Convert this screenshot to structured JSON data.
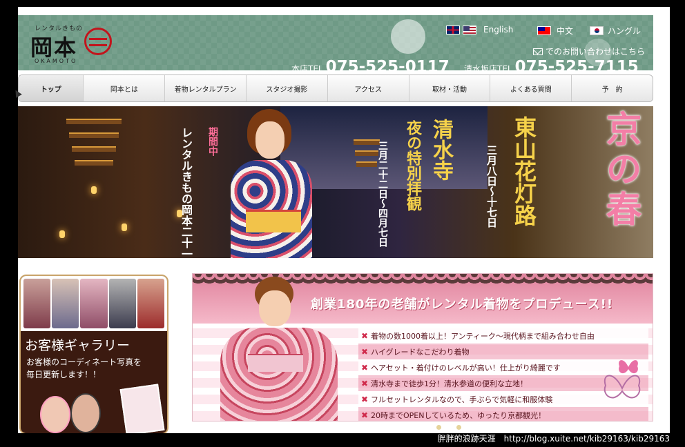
{
  "logo": {
    "kana": "レンタルきもの",
    "name": "岡本",
    "roman": "OKAMOTO"
  },
  "languages": [
    {
      "label": "English",
      "flags": [
        "uk-flag-icon",
        "us-flag-icon"
      ]
    },
    {
      "label": "中文",
      "flags": [
        "tw-flag-icon"
      ]
    },
    {
      "label": "ハングル",
      "flags": [
        "kr-flag-icon"
      ]
    }
  ],
  "contact": {
    "label": "でのお問い合わせはこちら",
    "icon": "mail-icon"
  },
  "phones": [
    {
      "label": "本店TEL",
      "number": "075-525-0117"
    },
    {
      "label": "清水坂店TEL",
      "number": "075-525-7115"
    }
  ],
  "nav": [
    {
      "label": "トップ",
      "active": true
    },
    {
      "label": "岡本とは"
    },
    {
      "label": "着物レンタルプラン"
    },
    {
      "label": "スタジオ撮影"
    },
    {
      "label": "アクセス"
    },
    {
      "label": "取材・活動"
    },
    {
      "label": "よくある質問"
    },
    {
      "label": "予　約"
    }
  ],
  "banner": {
    "period_label": "期間中",
    "hours": "レンタルきもの岡本二十一時まで営業",
    "kiyomizu_title": "清水寺",
    "kiyomizu_sub": "夜の特別拝観",
    "kiyomizu_dates": "三月二十二日〜四月七日",
    "hanatoro_title": "東山花灯路",
    "hanatoro_dates": "三月八日〜十七日",
    "spring": "京の春",
    "colors": {
      "spring": "#f37ea6",
      "gold": "#f6d24a"
    }
  },
  "gallery": {
    "title": "お客様ギャラリー",
    "desc_line1": "お客様のコーディネート写真を",
    "desc_line2": "毎日更新します！！"
  },
  "promo": {
    "title": "創業180年の老舗がレンタル着物をプロデュース!!",
    "items": [
      "着物の数1000着以上！アンティーク〜現代柄まで組み合わせ自由",
      "ハイグレードなこだわり着物",
      "ヘアセット・着付けのレベルが高い！仕上がり綺麗です",
      "清水寺まで徒歩1分！清水参道の便利な立地！",
      "フルセットレンタルなので、手ぶらで気軽に和服体験",
      "20時までOPENしているため、ゆったり京都観光！"
    ],
    "mark": "✖"
  },
  "watermark": "胖胖的浪跡天涯　http://blog.xuite.net/kib29163/kib29163"
}
